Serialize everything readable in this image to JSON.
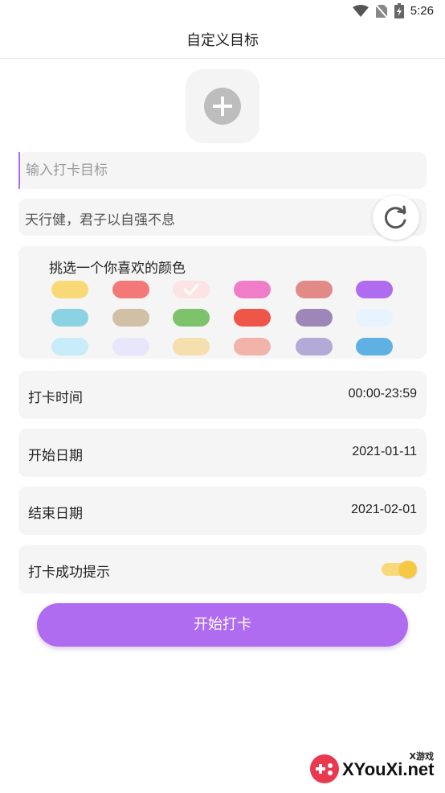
{
  "status_bar": {
    "time": "5:26"
  },
  "header": {
    "title": "自定义目标"
  },
  "goal_input": {
    "placeholder": "输入打卡目标",
    "value": ""
  },
  "motto": {
    "text": "天行健，君子以自强不息"
  },
  "color_picker": {
    "title": "挑选一个你喜欢的颜色",
    "selected_index": 2,
    "colors": [
      "#f9d976",
      "#f57878",
      "#fde3e3",
      "#f07dc8",
      "#e28a88",
      "#b06cf0",
      "#8bd3e3",
      "#d1c0a6",
      "#7cc36b",
      "#ed5648",
      "#9d87b9",
      "#e7f3fe",
      "#c8ecf8",
      "#e7e6fb",
      "#f5dfae",
      "#f2b4aa",
      "#b3aad8",
      "#5fb1e3"
    ]
  },
  "settings": {
    "time_label": "打卡时间",
    "time_value": "00:00-23:59",
    "start_label": "开始日期",
    "start_value": "2021-01-11",
    "end_label": "结束日期",
    "end_value": "2021-02-01",
    "notify_label": "打卡成功提示",
    "notify_on": true
  },
  "primary_button": {
    "label": "开始打卡"
  },
  "watermark": {
    "small_text": "X游戏",
    "big_text": "XYouXi.net"
  },
  "theme": {
    "accent": "#b06cf0",
    "card_bg": "#f5f5f5",
    "toggle_on": "#f7c843"
  }
}
